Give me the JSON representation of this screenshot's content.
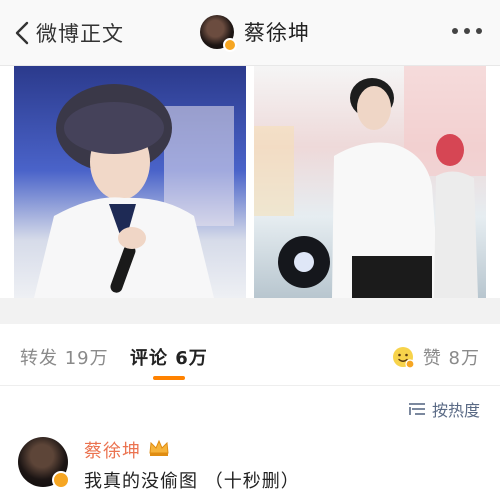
{
  "nav": {
    "back_label": "微博正文",
    "user_name": "蔡徐坤"
  },
  "tabs": {
    "repost_label": "转发",
    "repost_count": "19万",
    "comment_label": "评论",
    "comment_count": "6万",
    "like_label": "赞",
    "like_count": "8万"
  },
  "sort": {
    "label": "按热度"
  },
  "comment": {
    "author": "蔡徐坤",
    "text": "我真的没偷图 （十秒删）"
  },
  "colors": {
    "accent": "#ff8200",
    "verified_badge": "#f6a623",
    "author_name": "#eb7350",
    "sort_text": "#5a6a85"
  }
}
